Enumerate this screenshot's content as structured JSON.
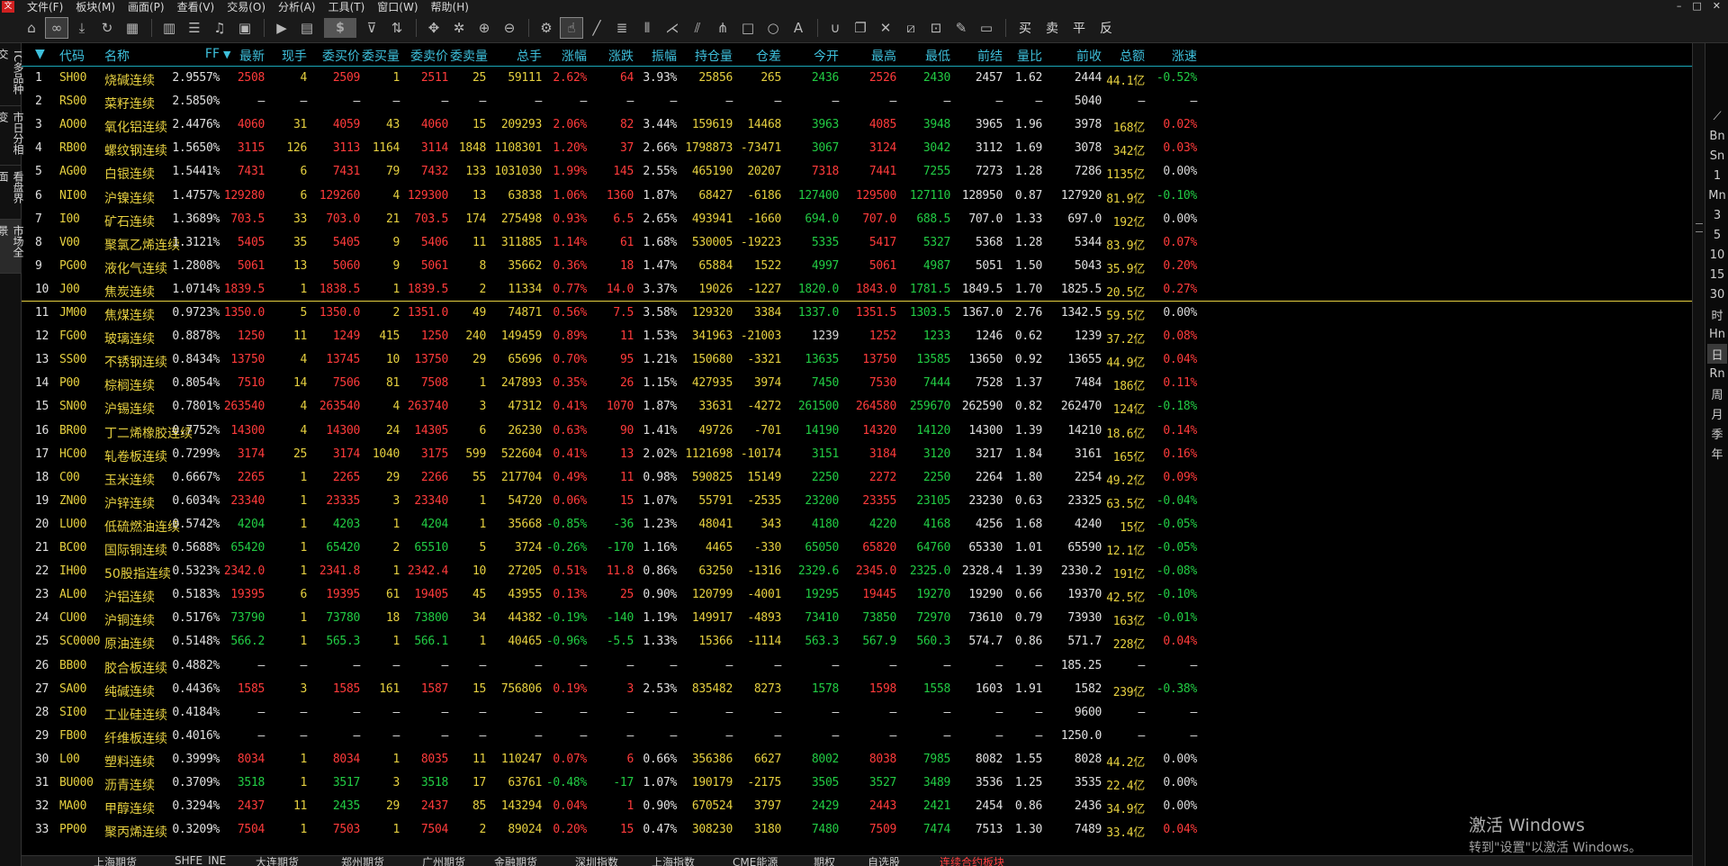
{
  "menu": {
    "items": [
      "文件(F)",
      "板块(M)",
      "画面(P)",
      "查看(V)",
      "交易(O)",
      "分析(A)",
      "工具(T)",
      "窗口(W)",
      "帮助(H)"
    ],
    "window_controls": [
      "–",
      "□",
      "✕"
    ]
  },
  "toolbar": {
    "dollar": "$",
    "trade_buttons": [
      "买",
      "卖",
      "平",
      "反"
    ]
  },
  "left_tabs": [
    "TC多品种交",
    "市日分相变",
    "看盘界面",
    "市场全景"
  ],
  "right_periods": [
    "Bn",
    "Sn",
    "1",
    "Mn",
    "3",
    "5",
    "10",
    "15",
    "30",
    "时",
    "Hn",
    "日",
    "Rn",
    "周",
    "月",
    "季",
    "年"
  ],
  "table": {
    "headers": [
      "代码",
      "名称",
      "FF",
      "最新",
      "现手",
      "委买价",
      "委买量",
      "委卖价",
      "委卖量",
      "总手",
      "涨幅",
      "涨跌",
      "振幅",
      "持仓量",
      "仓差",
      "今开",
      "最高",
      "最低",
      "前结",
      "量比",
      "前收",
      "总额",
      "涨速"
    ],
    "rows": [
      [
        "1",
        "SH00",
        "烧碱连续",
        "2.9557%",
        "2508",
        "4",
        "2509",
        "1",
        "2511",
        "25",
        "59111",
        "2.62%",
        "64",
        "3.93%",
        "25856",
        "265",
        "2436",
        "2526",
        "2430",
        "2457",
        "1.62",
        "2444",
        "44.1亿",
        "-0.52%"
      ],
      [
        "2",
        "RS00",
        "菜籽连续",
        "2.5850%",
        "—",
        "—",
        "—",
        "—",
        "—",
        "—",
        "—",
        "—",
        "—",
        "—",
        "—",
        "—",
        "—",
        "—",
        "—",
        "—",
        "—",
        "5040",
        "—",
        "—"
      ],
      [
        "3",
        "AO00",
        "氧化铝连续",
        "2.4476%",
        "4060",
        "31",
        "4059",
        "43",
        "4060",
        "15",
        "209293",
        "2.06%",
        "82",
        "3.44%",
        "159619",
        "14468",
        "3963",
        "4085",
        "3948",
        "3965",
        "1.96",
        "3978",
        "168亿",
        "0.02%"
      ],
      [
        "4",
        "RB00",
        "螺纹钢连续",
        "1.5650%",
        "3115",
        "126",
        "3113",
        "1164",
        "3114",
        "1848",
        "1108301",
        "1.20%",
        "37",
        "2.66%",
        "1798873",
        "-73471",
        "3067",
        "3124",
        "3042",
        "3112",
        "1.69",
        "3078",
        "342亿",
        "0.03%"
      ],
      [
        "5",
        "AG00",
        "白银连续",
        "1.5441%",
        "7431",
        "6",
        "7431",
        "79",
        "7432",
        "133",
        "1031030",
        "1.99%",
        "145",
        "2.55%",
        "465190",
        "20207",
        "7318",
        "7441",
        "7255",
        "7273",
        "1.28",
        "7286",
        "1135亿",
        "0.00%"
      ],
      [
        "6",
        "NI00",
        "沪镍连续",
        "1.4757%",
        "129280",
        "6",
        "129260",
        "4",
        "129300",
        "13",
        "63838",
        "1.06%",
        "1360",
        "1.87%",
        "68427",
        "-6186",
        "127400",
        "129500",
        "127110",
        "128950",
        "0.87",
        "127920",
        "81.9亿",
        "-0.10%"
      ],
      [
        "7",
        "I00",
        "矿石连续",
        "1.3689%",
        "703.5",
        "33",
        "703.0",
        "21",
        "703.5",
        "174",
        "275498",
        "0.93%",
        "6.5",
        "2.65%",
        "493941",
        "-1660",
        "694.0",
        "707.0",
        "688.5",
        "707.0",
        "1.33",
        "697.0",
        "192亿",
        "0.00%"
      ],
      [
        "8",
        "V00",
        "聚氯乙烯连续",
        "1.3121%",
        "5405",
        "35",
        "5405",
        "9",
        "5406",
        "11",
        "311885",
        "1.14%",
        "61",
        "1.68%",
        "530005",
        "-19223",
        "5335",
        "5417",
        "5327",
        "5368",
        "1.28",
        "5344",
        "83.9亿",
        "0.07%"
      ],
      [
        "9",
        "PG00",
        "液化气连续",
        "1.2808%",
        "5061",
        "13",
        "5060",
        "9",
        "5061",
        "8",
        "35662",
        "0.36%",
        "18",
        "1.47%",
        "65884",
        "1522",
        "4997",
        "5061",
        "4987",
        "5051",
        "1.50",
        "5043",
        "35.9亿",
        "0.20%"
      ],
      [
        "10",
        "J00",
        "焦炭连续",
        "1.0714%",
        "1839.5",
        "1",
        "1838.5",
        "1",
        "1839.5",
        "2",
        "11334",
        "0.77%",
        "14.0",
        "3.37%",
        "19026",
        "-1227",
        "1820.0",
        "1843.0",
        "1781.5",
        "1849.5",
        "1.70",
        "1825.5",
        "20.5亿",
        "0.27%"
      ],
      [
        "11",
        "JM00",
        "焦煤连续",
        "0.9723%",
        "1350.0",
        "5",
        "1350.0",
        "2",
        "1351.0",
        "49",
        "74871",
        "0.56%",
        "7.5",
        "3.58%",
        "129320",
        "3384",
        "1337.0",
        "1351.5",
        "1303.5",
        "1367.0",
        "2.76",
        "1342.5",
        "59.5亿",
        "0.00%"
      ],
      [
        "12",
        "FG00",
        "玻璃连续",
        "0.8878%",
        "1250",
        "11",
        "1249",
        "415",
        "1250",
        "240",
        "149459",
        "0.89%",
        "11",
        "1.53%",
        "341963",
        "-21003",
        "1239",
        "1252",
        "1233",
        "1246",
        "0.62",
        "1239",
        "37.2亿",
        "0.08%"
      ],
      [
        "13",
        "SS00",
        "不锈钢连续",
        "0.8434%",
        "13750",
        "4",
        "13745",
        "10",
        "13750",
        "29",
        "65696",
        "0.70%",
        "95",
        "1.21%",
        "150680",
        "-3321",
        "13635",
        "13750",
        "13585",
        "13650",
        "0.92",
        "13655",
        "44.9亿",
        "0.04%"
      ],
      [
        "14",
        "P00",
        "棕榈连续",
        "0.8054%",
        "7510",
        "14",
        "7506",
        "81",
        "7508",
        "1",
        "247893",
        "0.35%",
        "26",
        "1.15%",
        "427935",
        "3974",
        "7450",
        "7530",
        "7444",
        "7528",
        "1.37",
        "7484",
        "186亿",
        "0.11%"
      ],
      [
        "15",
        "SN00",
        "沪锡连续",
        "0.7801%",
        "263540",
        "4",
        "263540",
        "4",
        "263740",
        "3",
        "47312",
        "0.41%",
        "1070",
        "1.87%",
        "33631",
        "-4272",
        "261500",
        "264580",
        "259670",
        "262590",
        "0.82",
        "262470",
        "124亿",
        "-0.18%"
      ],
      [
        "16",
        "BR00",
        "丁二烯橡胶连续",
        "0.7752%",
        "14300",
        "4",
        "14300",
        "24",
        "14305",
        "6",
        "26230",
        "0.63%",
        "90",
        "1.41%",
        "49726",
        "-701",
        "14190",
        "14320",
        "14120",
        "14300",
        "1.39",
        "14210",
        "18.6亿",
        "0.14%"
      ],
      [
        "17",
        "HC00",
        "轧卷板连续",
        "0.7299%",
        "3174",
        "25",
        "3174",
        "1040",
        "3175",
        "599",
        "522604",
        "0.41%",
        "13",
        "2.02%",
        "1121698",
        "-10174",
        "3151",
        "3184",
        "3120",
        "3217",
        "1.84",
        "3161",
        "165亿",
        "0.16%"
      ],
      [
        "18",
        "C00",
        "玉米连续",
        "0.6667%",
        "2265",
        "1",
        "2265",
        "29",
        "2266",
        "55",
        "217704",
        "0.49%",
        "11",
        "0.98%",
        "590825",
        "15149",
        "2250",
        "2272",
        "2250",
        "2264",
        "1.80",
        "2254",
        "49.2亿",
        "0.09%"
      ],
      [
        "19",
        "ZN00",
        "沪锌连续",
        "0.6034%",
        "23340",
        "1",
        "23335",
        "3",
        "23340",
        "1",
        "54720",
        "0.06%",
        "15",
        "1.07%",
        "55791",
        "-2535",
        "23200",
        "23355",
        "23105",
        "23230",
        "0.63",
        "23325",
        "63.5亿",
        "-0.04%"
      ],
      [
        "20",
        "LU00",
        "低硫燃油连续",
        "0.5742%",
        "4204",
        "1",
        "4203",
        "1",
        "4204",
        "1",
        "35668",
        "-0.85%",
        "-36",
        "1.23%",
        "48041",
        "343",
        "4180",
        "4220",
        "4168",
        "4256",
        "1.68",
        "4240",
        "15亿",
        "-0.05%"
      ],
      [
        "21",
        "BC00",
        "国际铜连续",
        "0.5688%",
        "65420",
        "1",
        "65420",
        "2",
        "65510",
        "5",
        "3724",
        "-0.26%",
        "-170",
        "1.16%",
        "4465",
        "-330",
        "65050",
        "65820",
        "64760",
        "65330",
        "1.01",
        "65590",
        "12.1亿",
        "-0.05%"
      ],
      [
        "22",
        "IH00",
        "50股指连续",
        "0.5323%",
        "2342.0",
        "1",
        "2341.8",
        "1",
        "2342.4",
        "10",
        "27205",
        "0.51%",
        "11.8",
        "0.86%",
        "63250",
        "-1316",
        "2329.6",
        "2345.0",
        "2325.0",
        "2328.4",
        "1.39",
        "2330.2",
        "191亿",
        "-0.08%"
      ],
      [
        "23",
        "AL00",
        "沪铝连续",
        "0.5183%",
        "19395",
        "6",
        "19395",
        "61",
        "19405",
        "45",
        "43955",
        "0.13%",
        "25",
        "0.90%",
        "120799",
        "-4001",
        "19295",
        "19445",
        "19270",
        "19290",
        "0.66",
        "19370",
        "42.5亿",
        "-0.10%"
      ],
      [
        "24",
        "CU00",
        "沪铜连续",
        "0.5176%",
        "73790",
        "1",
        "73780",
        "18",
        "73800",
        "34",
        "44382",
        "-0.19%",
        "-140",
        "1.19%",
        "149917",
        "-4893",
        "73410",
        "73850",
        "72970",
        "73610",
        "0.79",
        "73930",
        "163亿",
        "-0.01%"
      ],
      [
        "25",
        "SC0000",
        "原油连续",
        "0.5148%",
        "566.2",
        "1",
        "565.3",
        "1",
        "566.1",
        "1",
        "40465",
        "-0.96%",
        "-5.5",
        "1.33%",
        "15366",
        "-1114",
        "563.3",
        "567.9",
        "560.3",
        "574.7",
        "0.86",
        "571.7",
        "228亿",
        "0.04%"
      ],
      [
        "26",
        "BB00",
        "胶合板连续",
        "0.4882%",
        "—",
        "—",
        "—",
        "—",
        "—",
        "—",
        "—",
        "—",
        "—",
        "—",
        "—",
        "—",
        "—",
        "—",
        "—",
        "—",
        "—",
        "185.25",
        "—",
        "—"
      ],
      [
        "27",
        "SA00",
        "纯碱连续",
        "0.4436%",
        "1585",
        "3",
        "1585",
        "161",
        "1587",
        "15",
        "756806",
        "0.19%",
        "3",
        "2.53%",
        "835482",
        "8273",
        "1578",
        "1598",
        "1558",
        "1603",
        "1.91",
        "1582",
        "239亿",
        "-0.38%"
      ],
      [
        "28",
        "SI00",
        "工业硅连续",
        "0.4184%",
        "—",
        "—",
        "—",
        "—",
        "—",
        "—",
        "—",
        "—",
        "—",
        "—",
        "—",
        "—",
        "—",
        "—",
        "—",
        "—",
        "—",
        "9600",
        "—",
        "—"
      ],
      [
        "29",
        "FB00",
        "纤维板连续",
        "0.4016%",
        "—",
        "—",
        "—",
        "—",
        "—",
        "—",
        "—",
        "—",
        "—",
        "—",
        "—",
        "—",
        "—",
        "—",
        "—",
        "—",
        "—",
        "1250.0",
        "—",
        "—"
      ],
      [
        "30",
        "L00",
        "塑料连续",
        "0.3999%",
        "8034",
        "1",
        "8034",
        "1",
        "8035",
        "11",
        "110247",
        "0.07%",
        "6",
        "0.66%",
        "356386",
        "6627",
        "8002",
        "8038",
        "7985",
        "8082",
        "1.55",
        "8028",
        "44.2亿",
        "0.00%"
      ],
      [
        "31",
        "BU000",
        "沥青连续",
        "0.3709%",
        "3518",
        "1",
        "3517",
        "3",
        "3518",
        "17",
        "63761",
        "-0.48%",
        "-17",
        "1.07%",
        "190179",
        "-2175",
        "3505",
        "3527",
        "3489",
        "3536",
        "1.25",
        "3535",
        "22.4亿",
        "0.00%"
      ],
      [
        "32",
        "MA00",
        "甲醇连续",
        "0.3294%",
        "2437",
        "11",
        "2435",
        "29",
        "2437",
        "85",
        "143294",
        "0.04%",
        "1",
        "0.90%",
        "670524",
        "3797",
        "2429",
        "2443",
        "2421",
        "2454",
        "0.86",
        "2436",
        "34.9亿",
        "0.00%"
      ],
      [
        "33",
        "PP00",
        "聚丙烯连续",
        "0.3209%",
        "7504",
        "1",
        "7503",
        "1",
        "7504",
        "2",
        "89024",
        "0.20%",
        "15",
        "0.47%",
        "308230",
        "3180",
        "7480",
        "7509",
        "7474",
        "7513",
        "1.30",
        "7489",
        "33.4亿",
        "0.04%"
      ]
    ]
  },
  "bottom_tabs": [
    "上海期货",
    "SHFE_INE",
    "大连期货",
    "郑州期货",
    "广州期货",
    "金融期货",
    "深圳指数",
    "上海指数",
    "CME能源",
    "期权",
    "自选股",
    "连续合约板块"
  ],
  "watermark": {
    "line1": "激活 Windows",
    "line2": "转到\"设置\"以激活 Windows。"
  }
}
